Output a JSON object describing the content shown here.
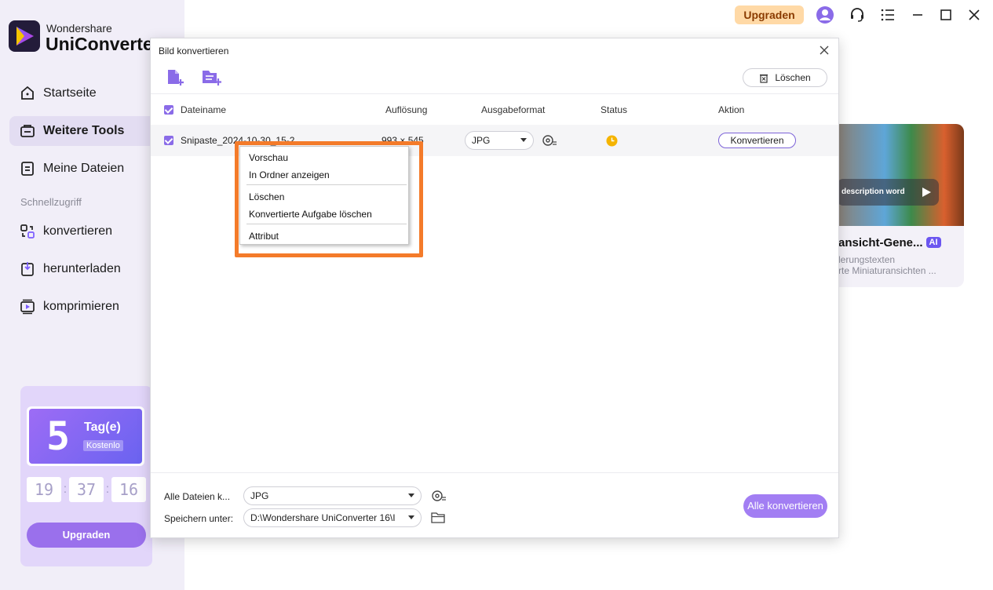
{
  "app": {
    "brand_line1": "Wondershare",
    "brand_line2": "UniConverter",
    "upgrade_label": "Upgraden"
  },
  "sidebar": {
    "items": [
      {
        "label": "Startseite",
        "icon": "home-icon",
        "active": false
      },
      {
        "label": "Weitere Tools",
        "icon": "toolbox-icon",
        "active": true
      },
      {
        "label": "Meine Dateien",
        "icon": "files-icon",
        "active": false
      }
    ],
    "quick_access_label": "Schnellzugriff",
    "quick_items": [
      {
        "label": "konvertieren",
        "icon": "convert-icon"
      },
      {
        "label": "herunterladen",
        "icon": "download-icon"
      },
      {
        "label": "komprimieren",
        "icon": "compress-icon"
      }
    ],
    "promo": {
      "days": "5",
      "days_label": "Tag(e)",
      "free_label": "Kostenlo",
      "timer": [
        "19",
        "37",
        "16"
      ],
      "button": "Upgraden"
    }
  },
  "background_card": {
    "pill_text": "description word",
    "title": "ansicht-Gene...",
    "badge": "AI",
    "desc_line1": "lerungstexten",
    "desc_line2": "rte Miniaturansichten ..."
  },
  "dialog": {
    "title": "Bild konvertieren",
    "clear_button": "Löschen",
    "columns": {
      "filename": "Dateiname",
      "resolution": "Auflösung",
      "format": "Ausgabeformat",
      "status": "Status",
      "action": "Aktion"
    },
    "rows": [
      {
        "filename": "Snipaste_2024-10-30_15-2...",
        "resolution": "993 × 545",
        "format": "JPG",
        "action": "Konvertieren"
      }
    ],
    "footer": {
      "all_files_label": "Alle Dateien k...",
      "all_files_format": "JPG",
      "save_label": "Speichern unter:",
      "save_path": "D:\\Wondershare UniConverter 16\\I",
      "convert_all": "Alle konvertieren"
    }
  },
  "context_menu": {
    "items": [
      "Vorschau",
      "In Ordner anzeigen",
      "Löschen",
      "Konvertierte Aufgabe löschen",
      "Attribut"
    ]
  },
  "colors": {
    "accent": "#8a6be8",
    "highlight": "#f47b2a",
    "upgrade_bg": "#ffd9a6"
  }
}
